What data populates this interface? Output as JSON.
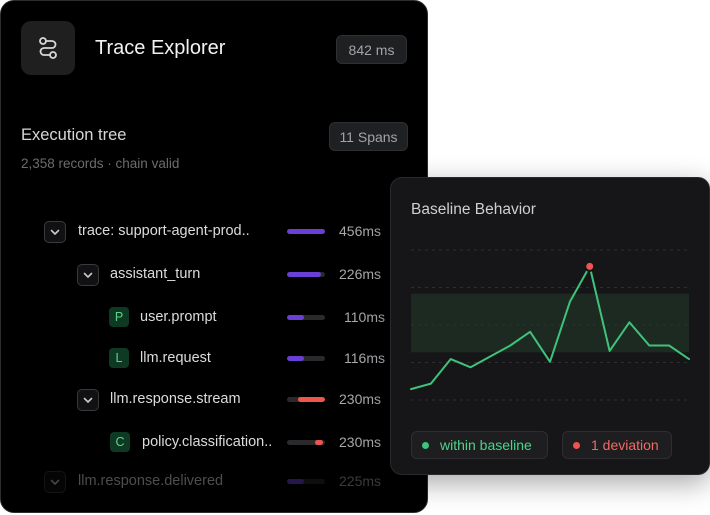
{
  "header": {
    "title": "Trace Explorer",
    "duration": "842 ms",
    "app_icon": "route-icon"
  },
  "execution": {
    "title": "Execution tree",
    "subtext": "2,358 records · chain valid",
    "spans_badge": "11 Spans"
  },
  "tree": [
    {
      "label": "trace: support-agent-prod..",
      "ms": "456ms",
      "kind": "chevron",
      "fill": 1.0,
      "color": "#6a3fd6"
    },
    {
      "label": "assistant_turn",
      "ms": "226ms",
      "kind": "chevron",
      "fill": 0.9,
      "color": "#6a3fd6"
    },
    {
      "label": "user.prompt",
      "ms": "110ms",
      "kind": "letter",
      "letter": "P",
      "fill": 0.45,
      "color": "#6a3fd6"
    },
    {
      "label": "llm.request",
      "ms": "116ms",
      "kind": "letter",
      "letter": "L",
      "fill": 0.45,
      "color": "#6a3fd6"
    },
    {
      "label": "llm.response.stream",
      "ms": "230ms",
      "kind": "chevron",
      "fill": 0.7,
      "offset": 0.3,
      "color": "#f0544f"
    },
    {
      "label": "policy.classification..",
      "ms": "230ms",
      "kind": "letter",
      "letter": "C",
      "fill": 0.22,
      "offset": 0.74,
      "color": "#f0544f"
    },
    {
      "label": "llm.response.delivered",
      "ms": "225ms",
      "kind": "chevron",
      "fill": 0.45,
      "color": "#6a3fd6",
      "faded": true
    }
  ],
  "baseline": {
    "title": "Baseline Behavior",
    "legend_within": "within baseline",
    "legend_deviation": "1 deviation",
    "colors": {
      "line": "#3fc27a",
      "deviation": "#f0544f",
      "band": "#1d2a22"
    }
  },
  "chart_data": {
    "type": "line",
    "y": [
      8,
      12,
      30,
      24,
      32,
      40,
      50,
      28,
      72,
      98,
      36,
      57,
      40,
      40,
      30
    ],
    "baseline_band": [
      35,
      78
    ],
    "deviation_index": 9,
    "ylim": [
      0,
      110
    ],
    "grid": true
  }
}
